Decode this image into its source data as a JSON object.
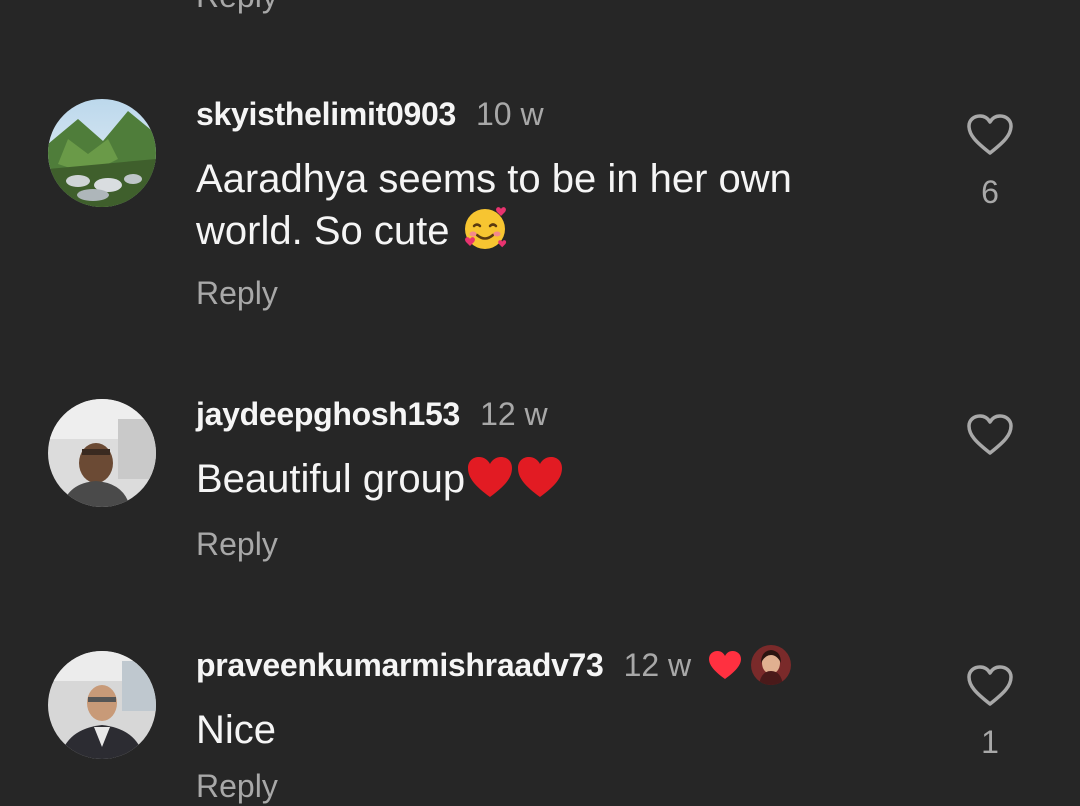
{
  "reply_label": "Reply",
  "colors": {
    "background": "#262626",
    "primary_text": "#f5f5f5",
    "secondary_text": "#a8a8a8",
    "heart_red": "#ff3040"
  },
  "comments": [
    {
      "username": "skyisthelimit0903",
      "time": "10 w",
      "text": "Aaradhya seems to be in her own world. So cute",
      "emoji": "smiling-face-with-hearts",
      "likes": "6",
      "reply": "Reply"
    },
    {
      "username": "jaydeepghosh153",
      "time": "12 w",
      "text": "Beautiful group",
      "emoji": "two-red-hearts",
      "likes": "",
      "reply": "Reply"
    },
    {
      "username": "praveenkumarmishraadv73",
      "time": "12 w",
      "text": "Nice",
      "creator_liked": true,
      "likes": "1",
      "reply": "Reply"
    }
  ]
}
